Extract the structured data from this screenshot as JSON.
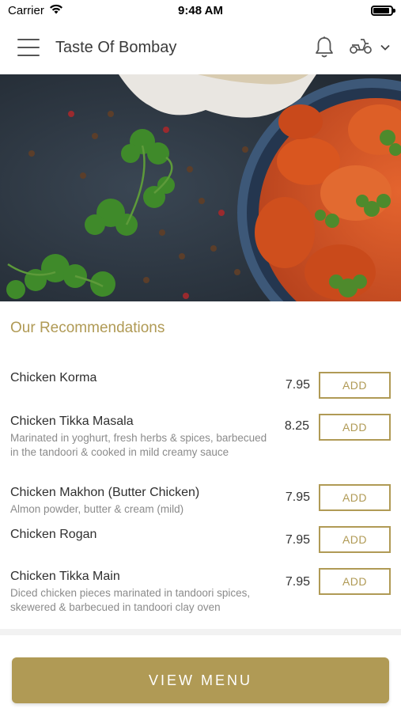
{
  "status_bar": {
    "carrier": "Carrier",
    "time": "9:48 AM",
    "battery_level": 0.9
  },
  "header": {
    "title": "Taste Of Bombay",
    "icons": [
      "menu-icon",
      "bell-icon",
      "scooter-icon",
      "chevron-down-icon"
    ]
  },
  "hero": {
    "image": "curry-dish-with-coriander-photo"
  },
  "recommendations": {
    "title": "Our Recommendations",
    "add_label": "ADD",
    "items": [
      {
        "name": "Chicken Korma",
        "description": "",
        "price": "7.95"
      },
      {
        "name": "Chicken Tikka Masala",
        "description": "Marinated in yoghurt, fresh herbs & spices, barbecued in the tandoori & cooked in mild creamy sauce",
        "price": "8.25"
      },
      {
        "name": "Chicken Makhon (Butter Chicken)",
        "description": "Almon powder, butter & cream (mild)",
        "price": "7.95"
      },
      {
        "name": "Chicken Rogan",
        "description": "",
        "price": "7.95"
      },
      {
        "name": "Chicken Tikka Main",
        "description": "Diced chicken pieces marinated in tandoori spices, skewered & barbecued in tandoori clay oven",
        "price": "7.95"
      }
    ]
  },
  "footer": {
    "view_menu_label": "VIEW MENU"
  },
  "colors": {
    "accent": "#b09a55",
    "text": "#2f2f2f",
    "muted": "#8b8b8b"
  }
}
